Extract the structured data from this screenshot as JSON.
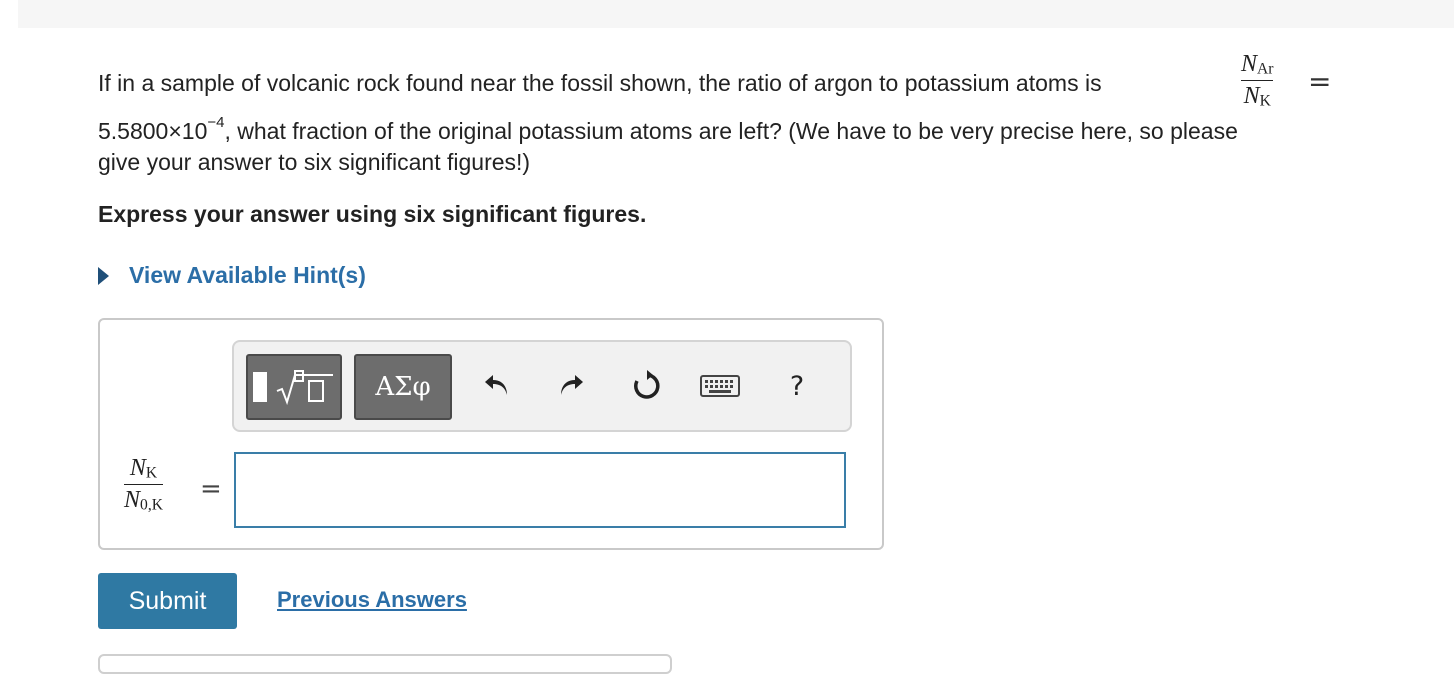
{
  "question": {
    "line1_text": "If in a sample of volcanic rock found near the fossil shown, the ratio of argon to potassium atoms is",
    "ratio_numerator": "N",
    "ratio_numerator_sub": "Ar",
    "ratio_denominator": "N",
    "ratio_denominator_sub": "K",
    "equals": "=",
    "value_mantissa": "5.5800×10",
    "value_exponent": "−4",
    "line2_rest": ", what fraction of the original potassium atoms are left? (We have to be very precise here, so please",
    "line3": "give your answer to six significant figures!)"
  },
  "instruction": "Express your answer using six significant figures.",
  "hint": {
    "label": "View Available Hint(s)"
  },
  "toolbar": {
    "templates_icon": "templates-icon",
    "greek_label": "ΑΣφ",
    "undo_icon": "undo-icon",
    "redo_icon": "redo-icon",
    "reset_icon": "reset-icon",
    "keyboard_icon": "keyboard-icon",
    "help_label": "?"
  },
  "answer": {
    "lhs_numerator": "N",
    "lhs_numerator_sub": "K",
    "lhs_denominator": "N",
    "lhs_denominator_sub": "0,K",
    "equals": "=",
    "input_value": ""
  },
  "actions": {
    "submit_label": "Submit",
    "previous_answers_label": "Previous Answers"
  },
  "colors": {
    "accent": "#2f79a3",
    "link": "#2b6ea7",
    "input_border": "#3a7ea8"
  }
}
